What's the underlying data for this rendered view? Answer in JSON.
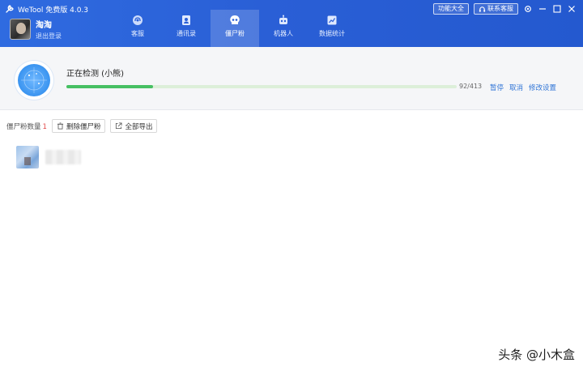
{
  "app": {
    "title": "WeTool 免费版 4.0.3"
  },
  "user": {
    "name": "淘淘",
    "logout_label": "退出登录"
  },
  "nav": {
    "tabs": [
      {
        "label": "客服",
        "icon": "headset-icon",
        "active": false
      },
      {
        "label": "通讯录",
        "icon": "contacts-icon",
        "active": false
      },
      {
        "label": "僵尸粉",
        "icon": "skull-icon",
        "active": true
      },
      {
        "label": "机器人",
        "icon": "robot-icon",
        "active": false
      },
      {
        "label": "数据统计",
        "icon": "stats-icon",
        "active": false
      }
    ]
  },
  "top_right": {
    "features_label": "功能大全",
    "support_label": "联系客服",
    "icons": [
      "settings-icon",
      "minimize-icon",
      "maximize-icon",
      "close-icon"
    ]
  },
  "detection": {
    "title": "正在检测 (小熊)",
    "progress_text": "92/413",
    "progress_fraction": 0.2228,
    "actions": [
      "暂停",
      "取消",
      "修改设置"
    ]
  },
  "toolbar": {
    "count_label": "僵尸粉数量",
    "count_value": "1",
    "delete_label": "删除僵尸粉",
    "export_label": "全部导出"
  },
  "watermark": "头条 @小木盒",
  "colors": {
    "header_blue": "#2a5fd6",
    "progress_green": "#46c063",
    "link_blue": "#2f74d6",
    "count_red": "#e24a4a"
  }
}
